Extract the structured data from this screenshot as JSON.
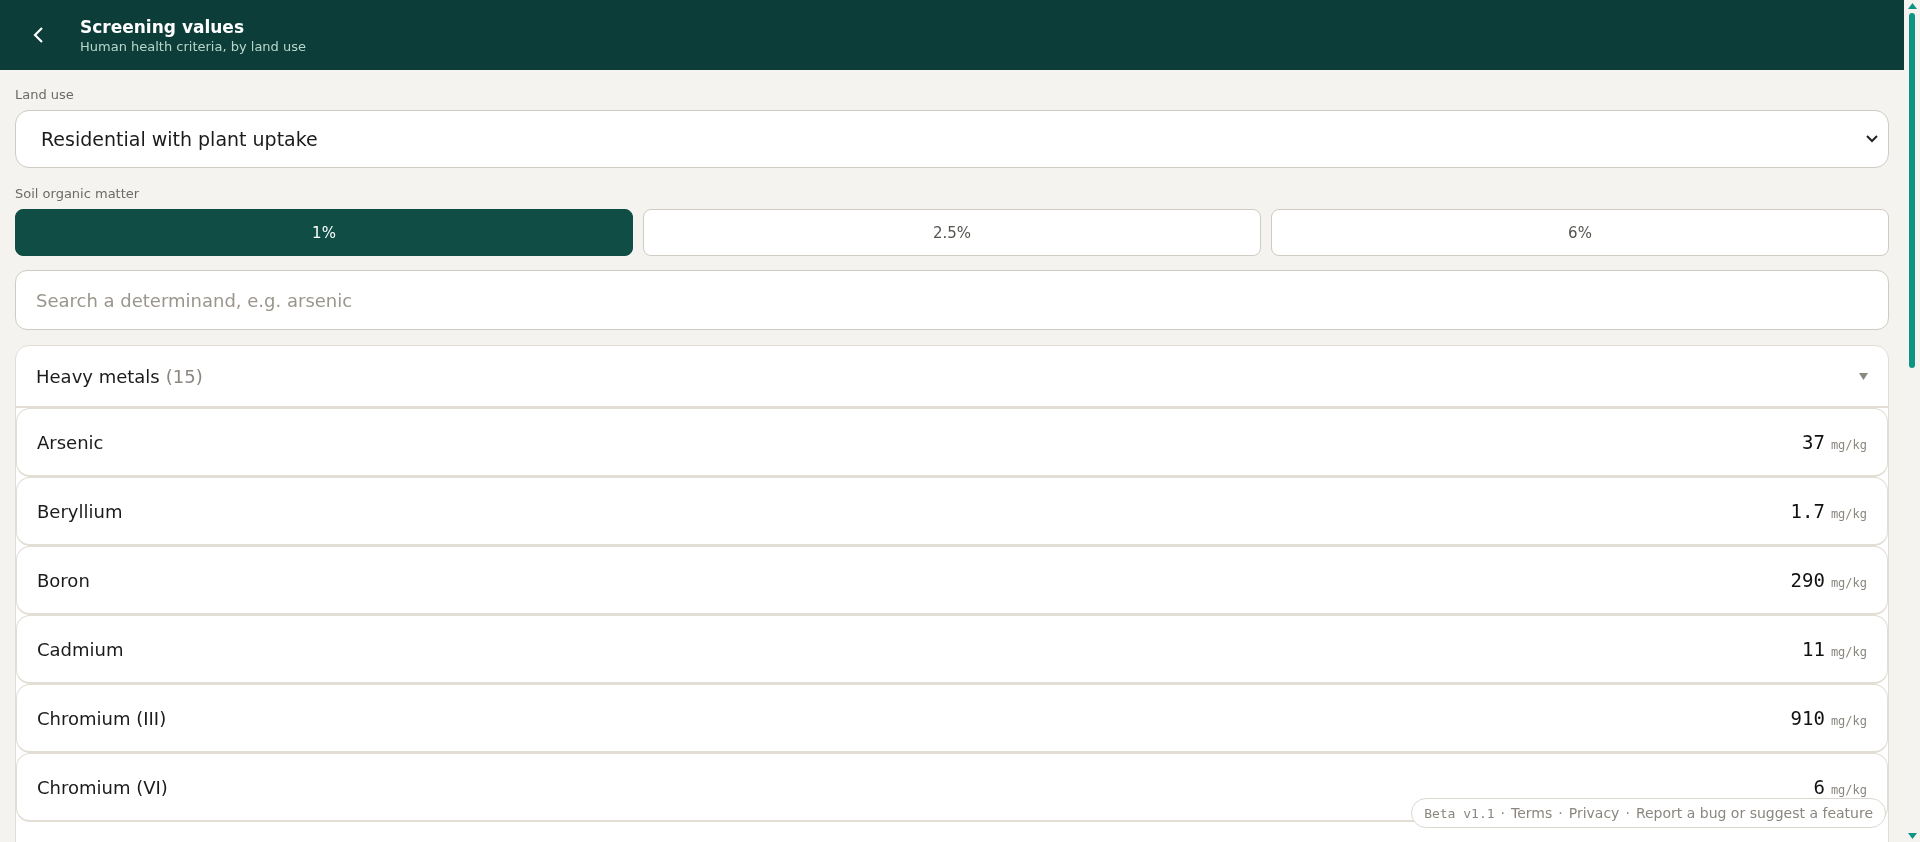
{
  "header": {
    "title": "Screening values",
    "subtitle": "Human health criteria, by land use"
  },
  "land_use": {
    "label": "Land use",
    "value": "Residential with plant uptake"
  },
  "soil_organic_matter": {
    "label": "Soil organic matter",
    "options": [
      {
        "label": "1%",
        "selected": true
      },
      {
        "label": "2.5%",
        "selected": false
      },
      {
        "label": "6%",
        "selected": false
      }
    ]
  },
  "search": {
    "placeholder": "Search a determinand, e.g. arsenic"
  },
  "groups": [
    {
      "name": "Heavy metals",
      "count": "(15)",
      "expanded": true,
      "rows": [
        {
          "name": "Arsenic",
          "value": "37",
          "unit": "mg/kg"
        },
        {
          "name": "Beryllium",
          "value": "1.7",
          "unit": "mg/kg"
        },
        {
          "name": "Boron",
          "value": "290",
          "unit": "mg/kg"
        },
        {
          "name": "Cadmium",
          "value": "11",
          "unit": "mg/kg"
        },
        {
          "name": "Chromium (III)",
          "value": "910",
          "unit": "mg/kg"
        },
        {
          "name": "Chromium (VI)",
          "value": "6",
          "unit": "mg/kg"
        }
      ]
    }
  ],
  "footer": {
    "version": "Beta v1.1",
    "separator": "·",
    "links": [
      "Terms",
      "Privacy",
      "Report a bug or suggest a feature"
    ]
  }
}
